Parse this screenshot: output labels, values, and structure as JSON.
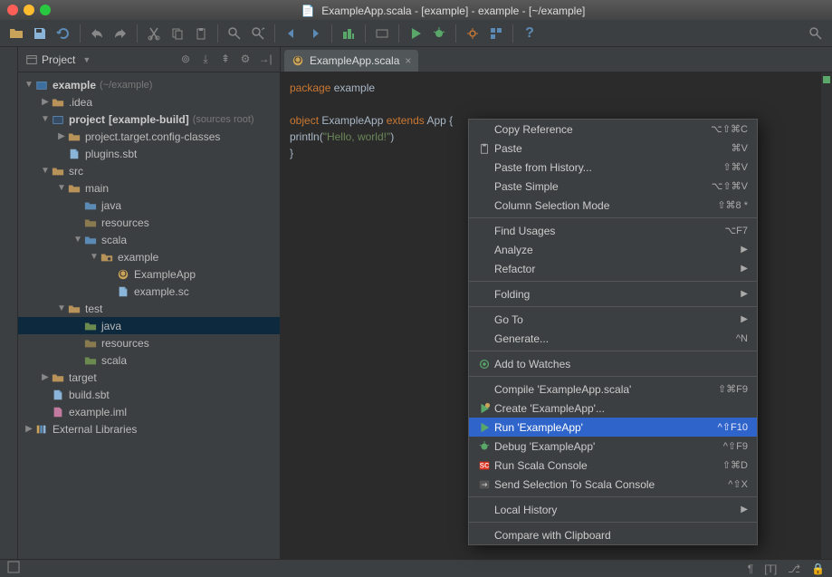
{
  "titlebar": {
    "text": "ExampleApp.scala - [example] - example - [~/example]"
  },
  "toolbar": {
    "help": "?"
  },
  "projectPanel": {
    "title": "Project"
  },
  "tree": [
    {
      "depth": 0,
      "arrow": "▼",
      "iconType": "module",
      "label": "example",
      "bold": true,
      "annotation": "(~/example)"
    },
    {
      "depth": 1,
      "arrow": "▶",
      "iconType": "folder",
      "label": ".idea"
    },
    {
      "depth": 1,
      "arrow": "▼",
      "iconType": "module-blue",
      "label": "project",
      "bold": true,
      "bracket": "[example-build]",
      "annotation": "(sources root)"
    },
    {
      "depth": 2,
      "arrow": "▶",
      "iconType": "folder",
      "label": "project.target.config-classes"
    },
    {
      "depth": 2,
      "arrow": "",
      "iconType": "file",
      "label": "plugins.sbt"
    },
    {
      "depth": 1,
      "arrow": "▼",
      "iconType": "folder",
      "label": "src"
    },
    {
      "depth": 2,
      "arrow": "▼",
      "iconType": "folder",
      "label": "main"
    },
    {
      "depth": 3,
      "arrow": "",
      "iconType": "folder-blue",
      "label": "java"
    },
    {
      "depth": 3,
      "arrow": "",
      "iconType": "folder-res",
      "label": "resources"
    },
    {
      "depth": 3,
      "arrow": "▼",
      "iconType": "folder-blue",
      "label": "scala"
    },
    {
      "depth": 4,
      "arrow": "▼",
      "iconType": "package",
      "label": "example"
    },
    {
      "depth": 5,
      "arrow": "",
      "iconType": "object",
      "label": "ExampleApp"
    },
    {
      "depth": 5,
      "arrow": "",
      "iconType": "file",
      "label": "example.sc"
    },
    {
      "depth": 2,
      "arrow": "▼",
      "iconType": "folder",
      "label": "test"
    },
    {
      "depth": 3,
      "arrow": "",
      "iconType": "folder-green",
      "label": "java",
      "selected": true
    },
    {
      "depth": 3,
      "arrow": "",
      "iconType": "folder-res",
      "label": "resources"
    },
    {
      "depth": 3,
      "arrow": "",
      "iconType": "folder-green",
      "label": "scala"
    },
    {
      "depth": 1,
      "arrow": "▶",
      "iconType": "folder",
      "label": "target"
    },
    {
      "depth": 1,
      "arrow": "",
      "iconType": "file",
      "label": "build.sbt"
    },
    {
      "depth": 1,
      "arrow": "",
      "iconType": "file-iml",
      "label": "example.iml"
    },
    {
      "depth": 0,
      "arrow": "▶",
      "iconType": "lib",
      "label": "External Libraries"
    }
  ],
  "editor": {
    "tabLabel": "ExampleApp.scala",
    "lines": [
      {
        "tokens": [
          {
            "t": "package ",
            "c": "kw"
          },
          {
            "t": "example",
            "c": "ident"
          }
        ]
      },
      {
        "tokens": []
      },
      {
        "tokens": [
          {
            "t": "object ",
            "c": "kw"
          },
          {
            "t": "ExampleApp ",
            "c": "ident"
          },
          {
            "t": "extends ",
            "c": "kw"
          },
          {
            "t": "App ",
            "c": "ident"
          },
          {
            "t": "{",
            "c": "ident"
          }
        ]
      },
      {
        "tokens": [
          {
            "t": "  println",
            "c": "ident"
          },
          {
            "t": "(",
            "c": "ident"
          },
          {
            "t": "\"Hello, world!\"",
            "c": "str"
          },
          {
            "t": ")",
            "c": "ident"
          }
        ]
      },
      {
        "tokens": [
          {
            "t": "}",
            "c": "ident"
          }
        ]
      }
    ]
  },
  "contextMenu": [
    {
      "type": "item",
      "label": "Copy Reference",
      "shortcut": "⌥⇧⌘C"
    },
    {
      "type": "item",
      "icon": "paste",
      "label": "Paste",
      "shortcut": "⌘V"
    },
    {
      "type": "item",
      "label": "Paste from History...",
      "shortcut": "⇧⌘V"
    },
    {
      "type": "item",
      "label": "Paste Simple",
      "shortcut": "⌥⇧⌘V"
    },
    {
      "type": "item",
      "label": "Column Selection Mode",
      "shortcut": "⇧⌘8 *"
    },
    {
      "type": "sep"
    },
    {
      "type": "item",
      "label": "Find Usages",
      "shortcut": "⌥F7"
    },
    {
      "type": "item",
      "label": "Analyze",
      "arrow": true
    },
    {
      "type": "item",
      "label": "Refactor",
      "arrow": true
    },
    {
      "type": "sep"
    },
    {
      "type": "item",
      "label": "Folding",
      "arrow": true
    },
    {
      "type": "sep"
    },
    {
      "type": "item",
      "label": "Go To",
      "arrow": true
    },
    {
      "type": "item",
      "label": "Generate...",
      "shortcut": "^N"
    },
    {
      "type": "sep"
    },
    {
      "type": "item",
      "icon": "watch",
      "label": "Add to Watches"
    },
    {
      "type": "sep"
    },
    {
      "type": "item",
      "label": "Compile 'ExampleApp.scala'",
      "shortcut": "⇧⌘F9"
    },
    {
      "type": "item",
      "icon": "create",
      "label": "Create 'ExampleApp'..."
    },
    {
      "type": "item",
      "icon": "run",
      "label": "Run 'ExampleApp'",
      "shortcut": "^⇧F10",
      "highlighted": true
    },
    {
      "type": "item",
      "icon": "debug",
      "label": "Debug 'ExampleApp'",
      "shortcut": "^⇧F9"
    },
    {
      "type": "item",
      "icon": "console",
      "label": "Run Scala Console",
      "shortcut": "⇧⌘D"
    },
    {
      "type": "item",
      "icon": "send",
      "label": "Send Selection To Scala Console",
      "shortcut": "^⇧X"
    },
    {
      "type": "sep"
    },
    {
      "type": "item",
      "label": "Local History",
      "arrow": true
    },
    {
      "type": "sep"
    },
    {
      "type": "item",
      "label": "Compare with Clipboard"
    }
  ],
  "statusbar": {
    "encoding": "[T]",
    "insert": "¶"
  }
}
